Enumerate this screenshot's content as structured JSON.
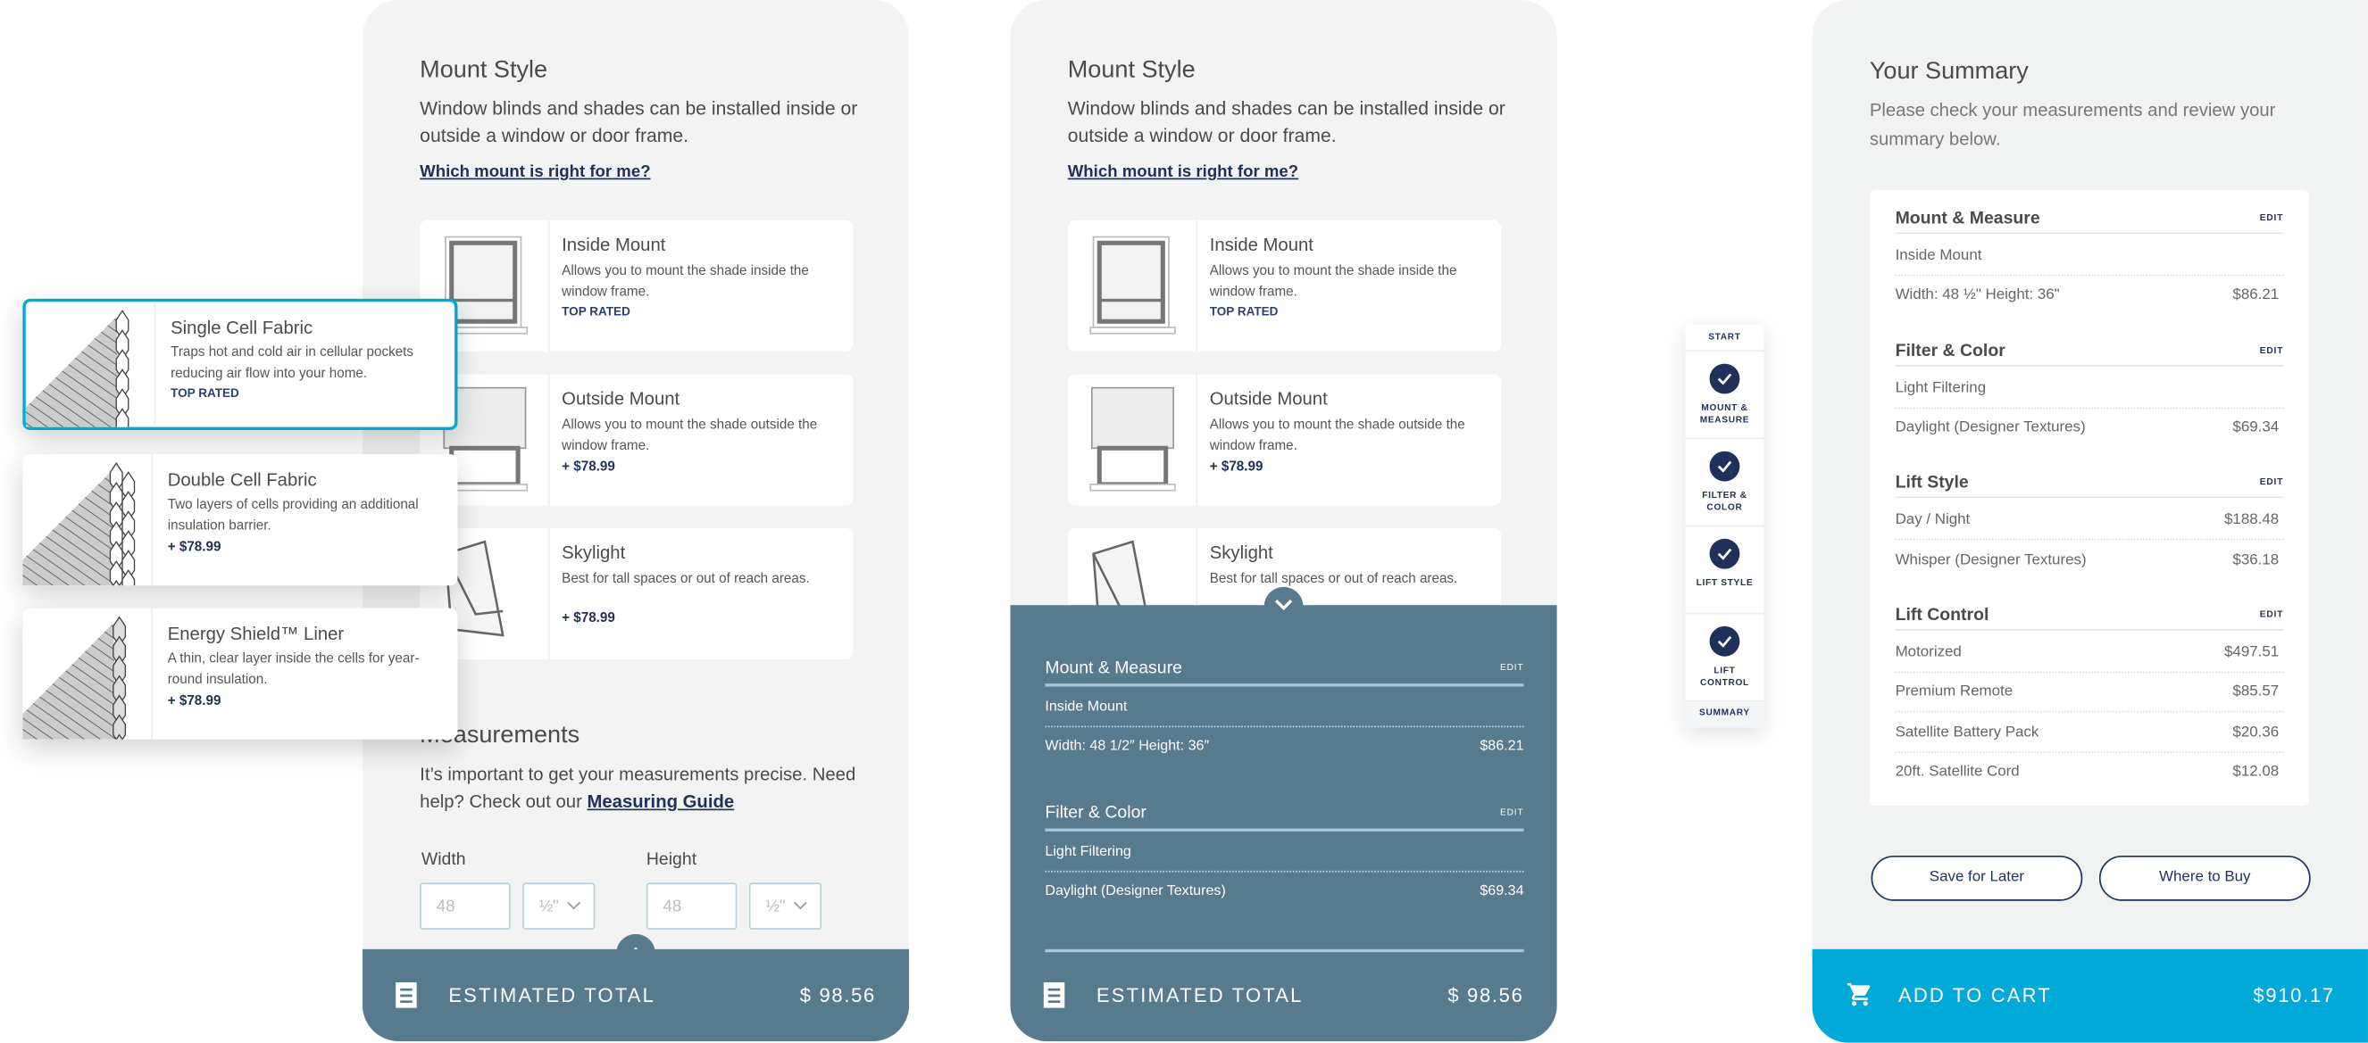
{
  "colors": {
    "accent": "#00a9d8",
    "navy": "#1f3158",
    "bar": "#587a8e"
  },
  "mount": {
    "title": "Mount Style",
    "description": "Window blinds and shades can be installed inside or outside a window or door frame.",
    "help_link": "Which mount is right for me?",
    "options": [
      {
        "title": "Inside Mount",
        "desc": "Allows you to mount the shade inside the window frame.",
        "tag": "TOP RATED",
        "price": ""
      },
      {
        "title": "Outside Mount",
        "desc": "Allows you to mount the shade outside the window frame.",
        "tag": "",
        "price": "+ $78.99"
      },
      {
        "title": "Skylight",
        "desc": "Best for tall spaces or out of reach areas.",
        "tag": "",
        "price": "+ $78.99"
      }
    ]
  },
  "fabrics": [
    {
      "title": "Single Cell Fabric",
      "desc": "Traps hot and cold air in cellular pockets reducing air flow into your home.",
      "tag": "TOP RATED",
      "price": "",
      "selected": true
    },
    {
      "title": "Double Cell Fabric",
      "desc": "Two layers of cells providing an additional insulation barrier.",
      "tag": "",
      "price": "+ $78.99",
      "selected": false
    },
    {
      "title": "Energy Shield™ Liner",
      "desc": "A thin, clear layer inside the cells for year-round insulation.",
      "tag": "",
      "price": "+ $78.99",
      "selected": false
    }
  ],
  "measurements": {
    "title": "Measurements",
    "text": "It’s important to get your measurements precise. Need help? Check out our",
    "guide_link": "Measuring Guide",
    "width_label": "Width",
    "height_label": "Height",
    "width_placeholder": "48",
    "height_placeholder": "48",
    "width_fraction": "½\"",
    "height_fraction": "½\""
  },
  "estimate": {
    "label": "ESTIMATED TOTAL",
    "amount": "$ 98.56"
  },
  "expanded": {
    "edit": "EDIT",
    "sections": [
      {
        "title": "Mount & Measure",
        "rows": [
          {
            "label": "Inside Mount",
            "price": ""
          },
          {
            "label": "Width: 48 1/2″ Height: 36″",
            "price": "$86.21"
          }
        ]
      },
      {
        "title": "Filter & Color",
        "rows": [
          {
            "label": "Light Filtering",
            "price": ""
          },
          {
            "label": "Daylight (Designer Textures)",
            "price": "$69.34"
          }
        ]
      }
    ]
  },
  "progress": {
    "start": "START",
    "steps": [
      "MOUNT & MEASURE",
      "FILTER & COLOR",
      "LIFT STYLE",
      "LIFT CONTROL"
    ],
    "summary": "SUMMARY"
  },
  "summary": {
    "title": "Your Summary",
    "description": "Please check your measurements and review your summary below.",
    "edit": "EDIT",
    "sections": [
      {
        "title": "Mount & Measure",
        "rows": [
          {
            "label": "Inside Mount",
            "price": ""
          },
          {
            "label": "Width: 48 ½\" Height: 36\"",
            "price": "$86.21"
          }
        ]
      },
      {
        "title": "Filter & Color",
        "rows": [
          {
            "label": "Light Filtering",
            "price": ""
          },
          {
            "label": "Daylight (Designer Textures)",
            "price": "$69.34"
          }
        ]
      },
      {
        "title": "Lift Style",
        "rows": [
          {
            "label": "Day / Night",
            "price": "$188.48"
          },
          {
            "label": "Whisper (Designer Textures)",
            "price": "$36.18"
          }
        ]
      },
      {
        "title": "Lift Control",
        "rows": [
          {
            "label": "Motorized",
            "price": "$497.51"
          },
          {
            "label": "Premium Remote",
            "price": "$85.57"
          },
          {
            "label": "Satellite Battery Pack",
            "price": "$20.36"
          },
          {
            "label": "20ft. Satellite Cord",
            "price": "$12.08"
          }
        ]
      }
    ],
    "save_label": "Save for Later",
    "where_label": "Where to Buy",
    "cart_label": "ADD TO CART",
    "cart_total": "$910.17"
  }
}
